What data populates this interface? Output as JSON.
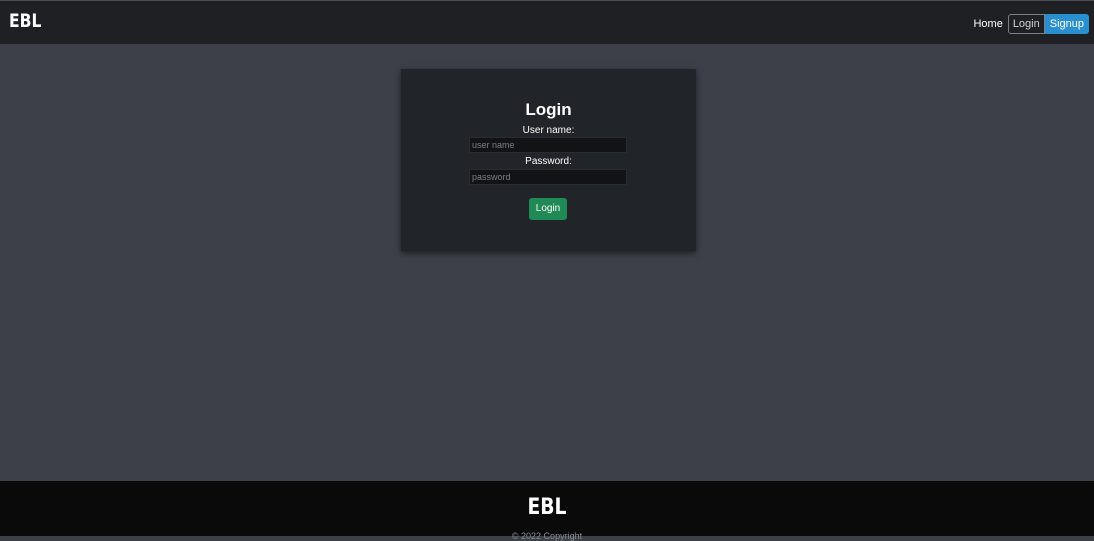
{
  "navbar": {
    "brand": "EBL",
    "links": {
      "home": "Home",
      "login": "Login",
      "signup": "Signup"
    }
  },
  "login_card": {
    "title": "Login",
    "username_label": "User name:",
    "username_placeholder": "user name",
    "username_value": "",
    "password_label": "Password:",
    "password_placeholder": "password",
    "password_value": "",
    "submit_label": "Login"
  },
  "footer": {
    "brand": "EBL",
    "copyright": "© 2022 Copyright"
  },
  "colors": {
    "page_background": "#3d4049",
    "navbar_background": "#1e2023",
    "card_background": "#212428",
    "signup_accent": "#2a8fcf",
    "submit_button": "#1f8a55",
    "footer_background": "#0a0a0a"
  }
}
